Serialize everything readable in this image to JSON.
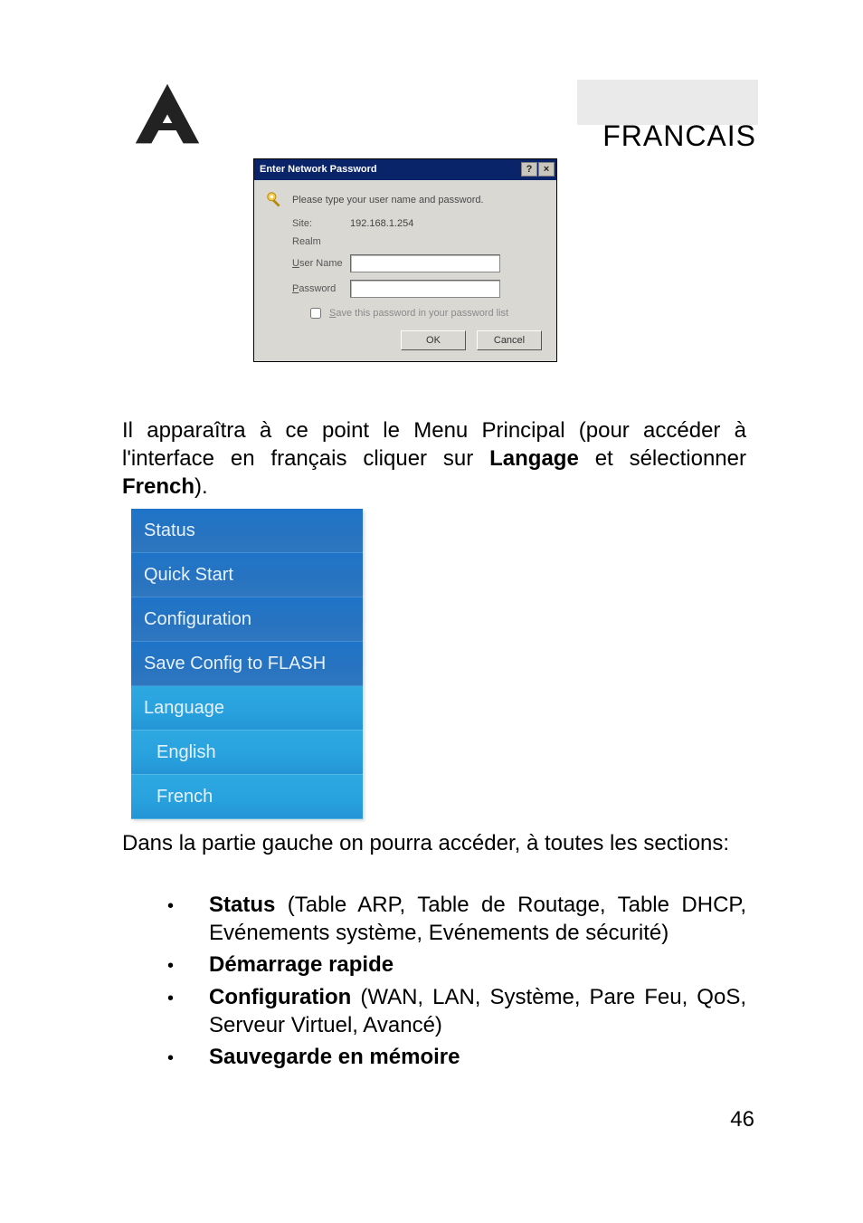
{
  "header": {
    "language_label": "FRANCAIS"
  },
  "dialog": {
    "title": "Enter Network Password",
    "prompt": "Please type your user name and password.",
    "site_label": "Site:",
    "site_value": "192.168.1.254",
    "realm_label": "Realm",
    "realm_value": "",
    "username_label": "User Name",
    "username_value": "",
    "password_label": "Password",
    "password_value": "",
    "save_checkbox_label": "Save this password in your password list",
    "ok_label": "OK",
    "cancel_label": "Cancel",
    "help_btn": "?",
    "close_btn": "×"
  },
  "paragraph1": {
    "pre": "Il apparaîtra à ce point le Menu Principal (pour accéder à l'interface en français cliquer sur ",
    "b1": "Langage",
    "mid": " et sélectionner ",
    "b2": "French",
    "post": ")."
  },
  "menu": {
    "items": [
      {
        "label": "Status",
        "variant": "dark"
      },
      {
        "label": "Quick Start",
        "variant": "dark"
      },
      {
        "label": "Configuration",
        "variant": "dark"
      },
      {
        "label": "Save Config to FLASH",
        "variant": "dark"
      },
      {
        "label": "Language",
        "variant": "light"
      },
      {
        "label": "English",
        "variant": "light",
        "sub": true
      },
      {
        "label": "French",
        "variant": "light",
        "sub": true
      }
    ]
  },
  "paragraph2": "Dans la partie gauche on pourra accéder, à toutes les sections:",
  "bullets": [
    {
      "bold": "Status",
      "rest": " (Table ARP, Table de Routage, Table DHCP, Evénements système, Evénements de sécurité)"
    },
    {
      "bold": "Démarrage rapide",
      "rest": ""
    },
    {
      "bold": "Configuration",
      "rest": " (WAN, LAN, Système, Pare Feu, QoS, Serveur Virtuel, Avancé)"
    },
    {
      "bold": "Sauvegarde en mémoire",
      "rest": ""
    }
  ],
  "page_number": "46"
}
